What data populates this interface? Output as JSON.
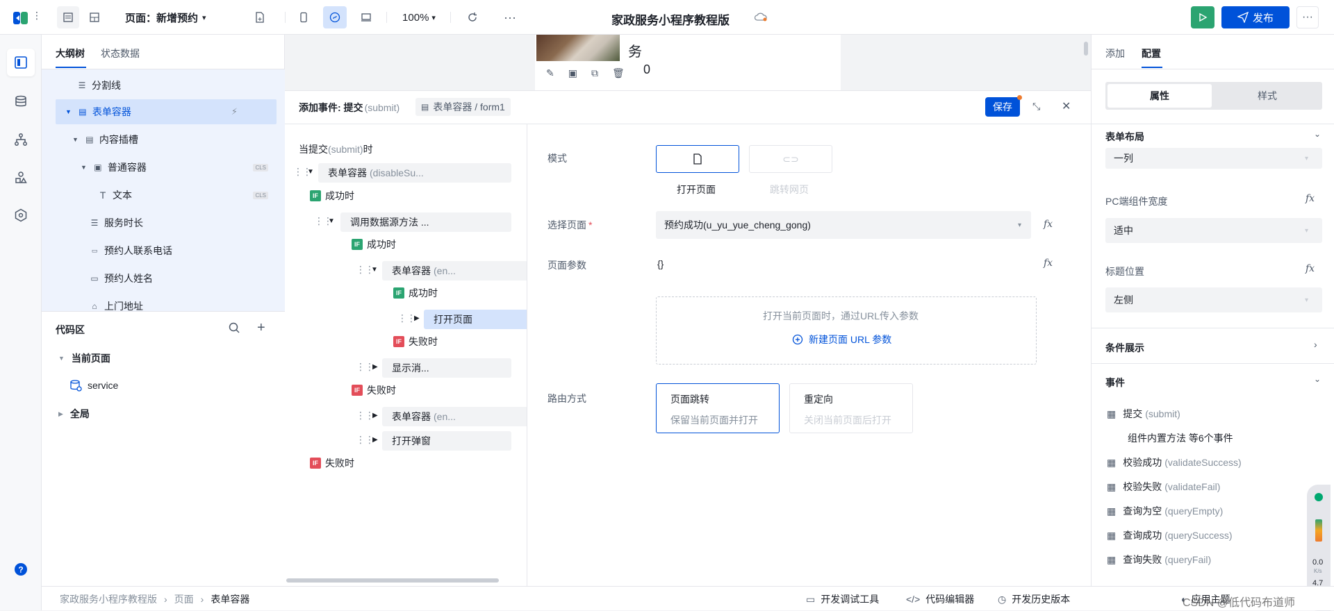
{
  "topbar": {
    "page_label": "页面：新增预约",
    "zoom": "100%",
    "app_title": "家政服务小程序教程版",
    "publish_label": "发布"
  },
  "outline": {
    "tabs": [
      "大纲树",
      "状态数据"
    ],
    "items": [
      {
        "label": "分割线"
      },
      {
        "label": "表单容器"
      },
      {
        "label": "内容插槽"
      },
      {
        "label": "普通容器",
        "badge": "CLS"
      },
      {
        "label": "文本",
        "badge": "CLS"
      },
      {
        "label": "服务时长"
      },
      {
        "label": "预约人联系电话"
      },
      {
        "label": "预约人姓名"
      },
      {
        "label": "上门地址"
      }
    ]
  },
  "code": {
    "title": "代码区",
    "current_page": "当前页面",
    "service": "service",
    "global": "全局"
  },
  "canvas": {
    "char1": "务",
    "char2": "0"
  },
  "event_panel": {
    "title": "添加事件: 提交",
    "title_event": "(submit)",
    "breadcrumb": "表单容器 / form1",
    "save_label": "保存",
    "trigger_prefix": "当提交",
    "trigger_event": "(submit)",
    "trigger_suffix": "时",
    "flow": {
      "n1": "表单容器",
      "n1_muted": "(disableSu...",
      "success1": "成功时",
      "n2": "调用数据源方法 ...",
      "success2": "成功时",
      "n3": "表单容器",
      "n3_muted": "(en...",
      "success3": "成功时",
      "n4": "打开页面",
      "fail3": "失败时",
      "n5": "显示消...",
      "fail2": "失败时",
      "n6": "表单容器",
      "n6_muted": "(en...",
      "n7": "打开弹窗",
      "fail1": "失败时"
    },
    "config": {
      "mode_label": "模式",
      "mode_open": "打开页面",
      "mode_jump": "跳转网页",
      "page_label": "选择页面",
      "page_value": "预约成功(u_yu_yue_cheng_gong)",
      "params_label": "页面参数",
      "params_value": "{}",
      "params_hint": "打开当前页面时，通过URL传入参数",
      "params_add": "新建页面 URL 参数",
      "route_label": "路由方式",
      "route1_title": "页面跳转",
      "route1_desc": "保留当前页面并打开",
      "route2_title": "重定向",
      "route2_desc": "关闭当前页面后打开"
    }
  },
  "rightpanel": {
    "tabs": [
      "添加",
      "配置"
    ],
    "seg": [
      "属性",
      "样式"
    ],
    "form_layout_title": "表单布局",
    "form_layout_value": "一列",
    "pc_width_label": "PC端组件宽度",
    "pc_width_value": "适中",
    "title_pos_label": "标题位置",
    "title_pos_value": "左侧",
    "cond_title": "条件展示",
    "events_title": "事件",
    "events": [
      {
        "name": "提交",
        "code": "(submit)"
      },
      {
        "name": "组件内置方法 等6个事件",
        "code": ""
      },
      {
        "name": "校验成功",
        "code": "(validateSuccess)"
      },
      {
        "name": "校验失败",
        "code": "(validateFail)"
      },
      {
        "name": "查询为空",
        "code": "(queryEmpty)"
      },
      {
        "name": "查询成功",
        "code": "(querySuccess)"
      },
      {
        "name": "查询失败",
        "code": "(queryFail)"
      }
    ]
  },
  "statusbar": {
    "crumbs": [
      "家政服务小程序教程版",
      "页面",
      "表单容器"
    ],
    "dev_tools": "开发调试工具",
    "code_editor": "代码编辑器",
    "history": "开发历史版本",
    "theme": "应用主题",
    "watermark": "CSDN @低代码布道师"
  },
  "widget": {
    "speed": "0.0",
    "unit": "K/s",
    "val": "4.7"
  },
  "colors": {
    "primary": "#0052d9",
    "green": "#00a870",
    "red": "#e34d59",
    "selected_bg": "#d4e3fc"
  }
}
